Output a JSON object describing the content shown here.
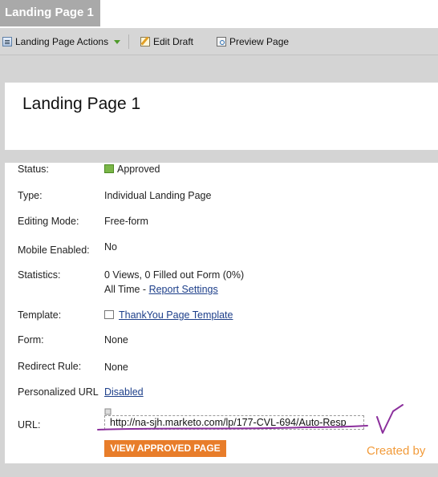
{
  "tab": {
    "label": "Landing Page 1"
  },
  "toolbar": {
    "actions_label": "Landing Page Actions",
    "edit_draft_label": "Edit Draft",
    "preview_label": "Preview Page"
  },
  "page": {
    "title": "Landing Page 1"
  },
  "details": {
    "status": {
      "label": "Status:",
      "value": "Approved"
    },
    "type": {
      "label": "Type:",
      "value": "Individual Landing Page"
    },
    "editing_mode": {
      "label": "Editing Mode:",
      "value": "Free-form"
    },
    "mobile_enabled": {
      "label": "Mobile Enabled:",
      "value": "No"
    },
    "statistics": {
      "label": "Statistics:",
      "line1": "0 Views, 0 Filled out Form (0%)",
      "line2_prefix": "All Time - ",
      "report_settings_link": "Report Settings"
    },
    "template": {
      "label": "Template:",
      "value": "ThankYou Page Template"
    },
    "form": {
      "label": "Form:",
      "value": "None"
    },
    "redirect_rule": {
      "label": "Redirect Rule:",
      "value": "None"
    },
    "personalized_url": {
      "label": "Personalized URL",
      "value": "Disabled"
    },
    "url": {
      "label": "URL:",
      "value": "http://na-sjh.marketo.com/lp/177-CVL-694/Auto-Resp"
    }
  },
  "buttons": {
    "view_approved": "VIEW APPROVED PAGE"
  },
  "annotation": {
    "text": "Created by",
    "color": "#f29b3a",
    "ink_color": "#8b2f9c"
  },
  "colors": {
    "accent_button": "#e87d2a",
    "link": "#1d3f8a",
    "tab_bg": "#a9a9a9"
  }
}
